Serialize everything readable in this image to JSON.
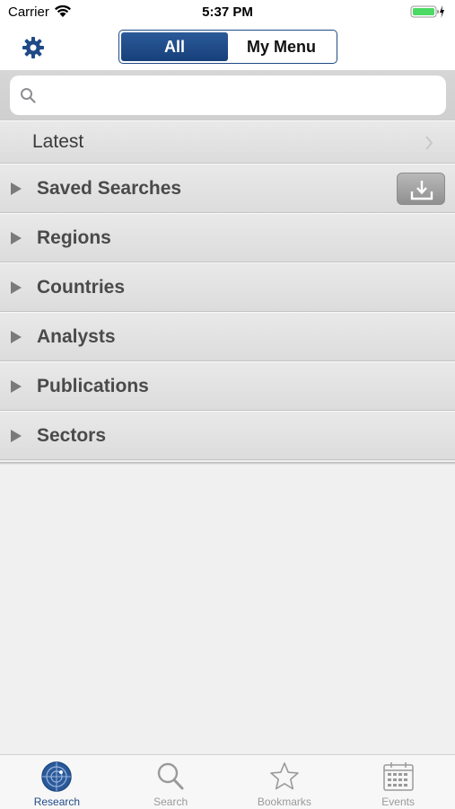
{
  "status_bar": {
    "carrier": "Carrier",
    "time": "5:37 PM"
  },
  "nav": {
    "segments": {
      "all": "All",
      "my_menu": "My Menu"
    },
    "selected": "All",
    "settings_icon": "gear-icon",
    "accent_color": "#1f4a86"
  },
  "search": {
    "placeholder": "",
    "value": ""
  },
  "menu": {
    "latest": "Latest",
    "items": [
      {
        "label": "Saved Searches"
      },
      {
        "label": "Regions"
      },
      {
        "label": "Countries"
      },
      {
        "label": "Analysts"
      },
      {
        "label": "Publications"
      },
      {
        "label": "Sectors"
      }
    ]
  },
  "tabs": [
    {
      "label": "Research",
      "icon": "radar-icon",
      "active": true
    },
    {
      "label": "Search",
      "icon": "search-icon",
      "active": false
    },
    {
      "label": "Bookmarks",
      "icon": "star-icon",
      "active": false
    },
    {
      "label": "Events",
      "icon": "calendar-icon",
      "active": false
    }
  ]
}
